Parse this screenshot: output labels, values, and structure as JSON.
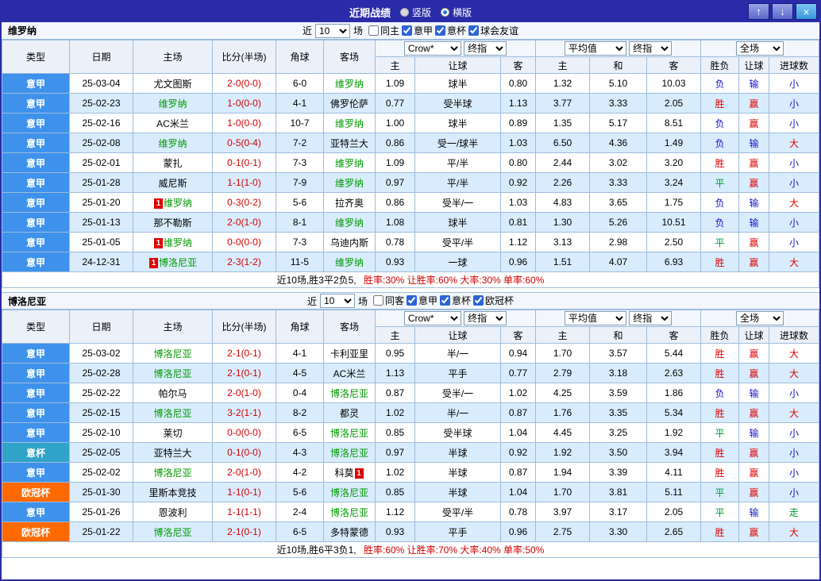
{
  "titlebar": {
    "title": "近期战绩",
    "radios": [
      {
        "label": "竖版",
        "selected": false
      },
      {
        "label": "横版",
        "selected": true
      }
    ],
    "icons": {
      "up": "↑",
      "down": "↓",
      "close": "×"
    }
  },
  "type_colors": {
    "意甲": "#3e92ec",
    "意杯": "#2fa3c8",
    "欧冠杯": "#ff6a00"
  },
  "result_colors": {
    "胜": "#e00000",
    "赢": "#e00000",
    "大": "#e00000",
    "负": "#1414cc",
    "输": "#1414cc",
    "小": "#1414cc",
    "平": "#009933",
    "走": "#009933"
  },
  "sections": [
    {
      "team": "维罗纳",
      "filter": {
        "near_label": "近",
        "count": "10",
        "games_label": "场",
        "checkboxes": [
          {
            "label": "同主",
            "checked": false
          },
          {
            "label": "意甲",
            "checked": true
          },
          {
            "label": "意杯",
            "checked": true
          },
          {
            "label": "球会友谊",
            "checked": true
          }
        ]
      },
      "header_selects": {
        "odds_company": "Crow*",
        "odds_stage": "终指",
        "avg": "平均值",
        "avg_stage": "终指",
        "scope": "全场"
      },
      "columns": {
        "type": "类型",
        "date": "日期",
        "home": "主场",
        "score": "比分(半场)",
        "corner": "角球",
        "away": "客场",
        "h": "主",
        "handicap": "让球",
        "a": "客",
        "avg_h": "主",
        "avg_d": "和",
        "avg_a": "客",
        "result": "胜负",
        "let_result": "让球",
        "goals": "进球数"
      },
      "rows": [
        {
          "type": "意甲",
          "date": "25-03-04",
          "home": "尤文图斯",
          "home_focus": false,
          "home_card": "",
          "score": "2-0(0-0)",
          "corner": "6-0",
          "away": "维罗纳",
          "away_focus": true,
          "away_card": "",
          "h": "1.09",
          "handicap": "球半",
          "a": "0.80",
          "avg_h": "1.32",
          "avg_d": "5.10",
          "avg_a": "10.03",
          "result": "负",
          "let": "输",
          "goals": "小"
        },
        {
          "type": "意甲",
          "date": "25-02-23",
          "home": "维罗纳",
          "home_focus": true,
          "home_card": "",
          "score": "1-0(0-0)",
          "corner": "4-1",
          "away": "佛罗伦萨",
          "away_focus": false,
          "away_card": "",
          "h": "0.77",
          "handicap": "受半球",
          "a": "1.13",
          "avg_h": "3.77",
          "avg_d": "3.33",
          "avg_a": "2.05",
          "result": "胜",
          "let": "赢",
          "goals": "小"
        },
        {
          "type": "意甲",
          "date": "25-02-16",
          "home": "AC米兰",
          "home_focus": false,
          "home_card": "",
          "score": "1-0(0-0)",
          "corner": "10-7",
          "away": "维罗纳",
          "away_focus": true,
          "away_card": "",
          "h": "1.00",
          "handicap": "球半",
          "a": "0.89",
          "avg_h": "1.35",
          "avg_d": "5.17",
          "avg_a": "8.51",
          "result": "负",
          "let": "赢",
          "goals": "小"
        },
        {
          "type": "意甲",
          "date": "25-02-08",
          "home": "维罗纳",
          "home_focus": true,
          "home_card": "",
          "score": "0-5(0-4)",
          "corner": "7-2",
          "away": "亚特兰大",
          "away_focus": false,
          "away_card": "",
          "h": "0.86",
          "handicap": "受一/球半",
          "a": "1.03",
          "avg_h": "6.50",
          "avg_d": "4.36",
          "avg_a": "1.49",
          "result": "负",
          "let": "输",
          "goals": "大"
        },
        {
          "type": "意甲",
          "date": "25-02-01",
          "home": "蒙扎",
          "home_focus": false,
          "home_card": "",
          "score": "0-1(0-1)",
          "corner": "7-3",
          "away": "维罗纳",
          "away_focus": true,
          "away_card": "",
          "h": "1.09",
          "handicap": "平/半",
          "a": "0.80",
          "avg_h": "2.44",
          "avg_d": "3.02",
          "avg_a": "3.20",
          "result": "胜",
          "let": "赢",
          "goals": "小"
        },
        {
          "type": "意甲",
          "date": "25-01-28",
          "home": "威尼斯",
          "home_focus": false,
          "home_card": "",
          "score": "1-1(1-0)",
          "corner": "7-9",
          "away": "维罗纳",
          "away_focus": true,
          "away_card": "",
          "h": "0.97",
          "handicap": "平/半",
          "a": "0.92",
          "avg_h": "2.26",
          "avg_d": "3.33",
          "avg_a": "3.24",
          "result": "平",
          "let": "赢",
          "goals": "小"
        },
        {
          "type": "意甲",
          "date": "25-01-20",
          "home": "维罗纳",
          "home_focus": true,
          "home_card": "1",
          "score": "0-3(0-2)",
          "corner": "5-6",
          "away": "拉齐奥",
          "away_focus": false,
          "away_card": "",
          "h": "0.86",
          "handicap": "受半/一",
          "a": "1.03",
          "avg_h": "4.83",
          "avg_d": "3.65",
          "avg_a": "1.75",
          "result": "负",
          "let": "输",
          "goals": "大"
        },
        {
          "type": "意甲",
          "date": "25-01-13",
          "home": "那不勒斯",
          "home_focus": false,
          "home_card": "",
          "score": "2-0(1-0)",
          "corner": "8-1",
          "away": "维罗纳",
          "away_focus": true,
          "away_card": "",
          "h": "1.08",
          "handicap": "球半",
          "a": "0.81",
          "avg_h": "1.30",
          "avg_d": "5.26",
          "avg_a": "10.51",
          "result": "负",
          "let": "输",
          "goals": "小"
        },
        {
          "type": "意甲",
          "date": "25-01-05",
          "home": "维罗纳",
          "home_focus": true,
          "home_card": "1",
          "score": "0-0(0-0)",
          "corner": "7-3",
          "away": "乌迪内斯",
          "away_focus": false,
          "away_card": "",
          "h": "0.78",
          "handicap": "受平/半",
          "a": "1.12",
          "avg_h": "3.13",
          "avg_d": "2.98",
          "avg_a": "2.50",
          "result": "平",
          "let": "赢",
          "goals": "小"
        },
        {
          "type": "意甲",
          "date": "24-12-31",
          "home": "博洛尼亚",
          "home_focus": true,
          "home_card": "1",
          "score": "2-3(1-2)",
          "corner": "11-5",
          "away": "维罗纳",
          "away_focus": true,
          "away_card": "",
          "h": "0.93",
          "handicap": "一球",
          "a": "0.96",
          "avg_h": "1.51",
          "avg_d": "4.07",
          "avg_a": "6.93",
          "result": "胜",
          "let": "赢",
          "goals": "大"
        }
      ],
      "summary": {
        "record": "近10场,胜3平2负5,",
        "rates": "胜率:30% 让胜率:60% 大率:30% 单率:60%"
      }
    },
    {
      "team": "博洛尼亚",
      "filter": {
        "near_label": "近",
        "count": "10",
        "games_label": "场",
        "checkboxes": [
          {
            "label": "同客",
            "checked": false
          },
          {
            "label": "意甲",
            "checked": true
          },
          {
            "label": "意杯",
            "checked": true
          },
          {
            "label": "欧冠杯",
            "checked": true
          }
        ]
      },
      "header_selects": {
        "odds_company": "Crow*",
        "odds_stage": "终指",
        "avg": "平均值",
        "avg_stage": "终指",
        "scope": "全场"
      },
      "columns": {
        "type": "类型",
        "date": "日期",
        "home": "主场",
        "score": "比分(半场)",
        "corner": "角球",
        "away": "客场",
        "h": "主",
        "handicap": "让球",
        "a": "客",
        "avg_h": "主",
        "avg_d": "和",
        "avg_a": "客",
        "result": "胜负",
        "let_result": "让球",
        "goals": "进球数"
      },
      "rows": [
        {
          "type": "意甲",
          "date": "25-03-02",
          "home": "博洛尼亚",
          "home_focus": true,
          "home_card": "",
          "score": "2-1(0-1)",
          "corner": "4-1",
          "away": "卡利亚里",
          "away_focus": false,
          "away_card": "",
          "h": "0.95",
          "handicap": "半/一",
          "a": "0.94",
          "avg_h": "1.70",
          "avg_d": "3.57",
          "avg_a": "5.44",
          "result": "胜",
          "let": "赢",
          "goals": "大"
        },
        {
          "type": "意甲",
          "date": "25-02-28",
          "home": "博洛尼亚",
          "home_focus": true,
          "home_card": "",
          "score": "2-1(0-1)",
          "corner": "4-5",
          "away": "AC米兰",
          "away_focus": false,
          "away_card": "",
          "h": "1.13",
          "handicap": "平手",
          "a": "0.77",
          "avg_h": "2.79",
          "avg_d": "3.18",
          "avg_a": "2.63",
          "result": "胜",
          "let": "赢",
          "goals": "大"
        },
        {
          "type": "意甲",
          "date": "25-02-22",
          "home": "帕尔马",
          "home_focus": false,
          "home_card": "",
          "score": "2-0(1-0)",
          "corner": "0-4",
          "away": "博洛尼亚",
          "away_focus": true,
          "away_card": "",
          "h": "0.87",
          "handicap": "受半/一",
          "a": "1.02",
          "avg_h": "4.25",
          "avg_d": "3.59",
          "avg_a": "1.86",
          "result": "负",
          "let": "输",
          "goals": "小"
        },
        {
          "type": "意甲",
          "date": "25-02-15",
          "home": "博洛尼亚",
          "home_focus": true,
          "home_card": "",
          "score": "3-2(1-1)",
          "corner": "8-2",
          "away": "都灵",
          "away_focus": false,
          "away_card": "",
          "h": "1.02",
          "handicap": "半/一",
          "a": "0.87",
          "avg_h": "1.76",
          "avg_d": "3.35",
          "avg_a": "5.34",
          "result": "胜",
          "let": "赢",
          "goals": "大"
        },
        {
          "type": "意甲",
          "date": "25-02-10",
          "home": "莱切",
          "home_focus": false,
          "home_card": "",
          "score": "0-0(0-0)",
          "corner": "6-5",
          "away": "博洛尼亚",
          "away_focus": true,
          "away_card": "",
          "h": "0.85",
          "handicap": "受半球",
          "a": "1.04",
          "avg_h": "4.45",
          "avg_d": "3.25",
          "avg_a": "1.92",
          "result": "平",
          "let": "输",
          "goals": "小"
        },
        {
          "type": "意杯",
          "date": "25-02-05",
          "home": "亚特兰大",
          "home_focus": false,
          "home_card": "",
          "score": "0-1(0-0)",
          "corner": "4-3",
          "away": "博洛尼亚",
          "away_focus": true,
          "away_card": "",
          "h": "0.97",
          "handicap": "半球",
          "a": "0.92",
          "avg_h": "1.92",
          "avg_d": "3.50",
          "avg_a": "3.94",
          "result": "胜",
          "let": "赢",
          "goals": "小"
        },
        {
          "type": "意甲",
          "date": "25-02-02",
          "home": "博洛尼亚",
          "home_focus": true,
          "home_card": "",
          "score": "2-0(1-0)",
          "corner": "4-2",
          "away": "科莫",
          "away_focus": false,
          "away_card": "1",
          "h": "1.02",
          "handicap": "半球",
          "a": "0.87",
          "avg_h": "1.94",
          "avg_d": "3.39",
          "avg_a": "4.11",
          "result": "胜",
          "let": "赢",
          "goals": "小"
        },
        {
          "type": "欧冠杯",
          "date": "25-01-30",
          "home": "里斯本竞技",
          "home_focus": false,
          "home_card": "",
          "score": "1-1(0-1)",
          "corner": "5-6",
          "away": "博洛尼亚",
          "away_focus": true,
          "away_card": "",
          "h": "0.85",
          "handicap": "半球",
          "a": "1.04",
          "avg_h": "1.70",
          "avg_d": "3.81",
          "avg_a": "5.11",
          "result": "平",
          "let": "赢",
          "goals": "小"
        },
        {
          "type": "意甲",
          "date": "25-01-26",
          "home": "恩波利",
          "home_focus": false,
          "home_card": "",
          "score": "1-1(1-1)",
          "corner": "2-4",
          "away": "博洛尼亚",
          "away_focus": true,
          "away_card": "",
          "h": "1.12",
          "handicap": "受平/半",
          "a": "0.78",
          "avg_h": "3.97",
          "avg_d": "3.17",
          "avg_a": "2.05",
          "result": "平",
          "let": "输",
          "goals": "走"
        },
        {
          "type": "欧冠杯",
          "date": "25-01-22",
          "home": "博洛尼亚",
          "home_focus": true,
          "home_card": "",
          "score": "2-1(0-1)",
          "corner": "6-5",
          "away": "多特蒙德",
          "away_focus": false,
          "away_card": "",
          "h": "0.93",
          "handicap": "平手",
          "a": "0.96",
          "avg_h": "2.75",
          "avg_d": "3.30",
          "avg_a": "2.65",
          "result": "胜",
          "let": "赢",
          "goals": "大"
        }
      ],
      "summary": {
        "record": "近10场,胜6平3负1,",
        "rates": "胜率:60% 让胜率:70% 大率:40% 单率:50%"
      }
    }
  ]
}
